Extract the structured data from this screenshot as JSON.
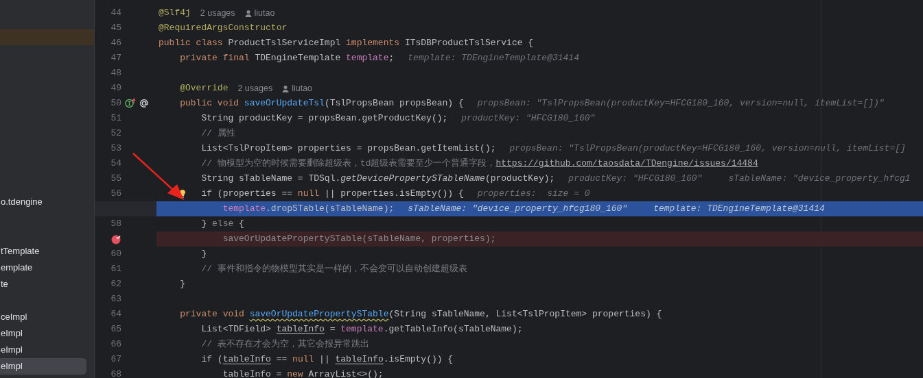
{
  "sidebar": {
    "items": [
      {
        "label": "o.tdengine",
        "selected": false
      },
      {
        "label": "tTemplate",
        "selected": false
      },
      {
        "label": "emplate",
        "selected": false
      },
      {
        "label": "te",
        "selected": false
      },
      {
        "label": "ceImpl",
        "selected": false
      },
      {
        "label": "eImpl",
        "selected": false
      },
      {
        "label": "eImpl",
        "selected": false
      },
      {
        "label": "eImpl",
        "selected": true
      }
    ]
  },
  "editor": {
    "lines": [
      {
        "number": "44",
        "kind": "normal",
        "code": [
          {
            "text": "@Slf4j",
            "kind": "annotation"
          }
        ],
        "hints": [
          {
            "kind": "usages",
            "text": "2 usages"
          },
          {
            "kind": "author",
            "text": "liutao"
          }
        ]
      },
      {
        "number": "45",
        "kind": "normal",
        "code": [
          {
            "text": "@RequiredArgsConstructor",
            "kind": "annotation"
          }
        ]
      },
      {
        "number": "46",
        "kind": "normal",
        "code": [
          {
            "text": "public class ",
            "kind": "keyword"
          },
          {
            "text": "ProductTslServiceImpl ",
            "kind": "plain"
          },
          {
            "text": "implements ",
            "kind": "keyword"
          },
          {
            "text": "ITsDBProductTslService {",
            "kind": "plain"
          }
        ]
      },
      {
        "number": "47",
        "kind": "normal",
        "code": [
          {
            "text": "    private final ",
            "kind": "keyword"
          },
          {
            "text": "TDEngineTemplate ",
            "kind": "plain"
          },
          {
            "text": "template",
            "kind": "field"
          },
          {
            "text": ";",
            "kind": "plain"
          }
        ],
        "hints": [
          {
            "kind": "value",
            "text": "template: TDEngineTemplate@31414"
          }
        ]
      },
      {
        "number": "48",
        "kind": "normal"
      },
      {
        "number": "49",
        "kind": "normal",
        "code": [
          {
            "text": "    @Override",
            "kind": "annotation"
          }
        ],
        "hints": [
          {
            "kind": "usages",
            "text": "2 usages"
          },
          {
            "kind": "author",
            "text": "liutao"
          }
        ]
      },
      {
        "number": "50",
        "kind": "normal",
        "icons": [
          {
            "kind": "override"
          },
          {
            "kind": "annotation"
          }
        ],
        "code": [
          {
            "text": "    public void ",
            "kind": "keyword"
          },
          {
            "text": "saveOrUpdateTsl",
            "kind": "method"
          },
          {
            "text": "(TslPropsBean propsBean) {",
            "kind": "plain"
          }
        ],
        "hints": [
          {
            "kind": "value",
            "text": "propsBean: \"TslPropsBean(productKey=HFCG180_160, version=null, itemList=[])\""
          }
        ]
      },
      {
        "number": "51",
        "kind": "normal",
        "code": [
          {
            "text": "        String productKey = propsBean.getProductKey();",
            "kind": "plain"
          }
        ],
        "hints": [
          {
            "kind": "value",
            "text": "productKey: \"HFCG180_160\""
          }
        ]
      },
      {
        "number": "52",
        "kind": "normal",
        "code": [
          {
            "text": "        // 属性",
            "kind": "comment"
          }
        ]
      },
      {
        "number": "53",
        "kind": "normal",
        "code": [
          {
            "text": "        List<TslPropItem> properties = propsBean.getItemList();",
            "kind": "plain"
          }
        ],
        "hints": [
          {
            "kind": "value",
            "text": "propsBean: \"TslPropsBean(productKey=HFCG180_160, version=null, itemList=[]"
          }
        ]
      },
      {
        "number": "54",
        "kind": "normal",
        "code": [
          {
            "text": "        // 物模型为空的时候需要删除超级表，td超级表需要至少一个普通字段，",
            "kind": "comment"
          },
          {
            "text": "https://github.com/taosdata/TDengine/issues/14484",
            "kind": "link"
          }
        ]
      },
      {
        "number": "55",
        "kind": "normal",
        "code": [
          {
            "text": "        String sTableName = TDSql.",
            "kind": "plain"
          },
          {
            "text": "getDevicePropertySTableName",
            "kind": "static"
          },
          {
            "text": "(productKey);",
            "kind": "plain"
          }
        ],
        "hints": [
          {
            "kind": "value",
            "text": "productKey: \"HFCG180_160\""
          },
          {
            "kind": "value",
            "text": "sTableName: \"device_property_hfcg1"
          }
        ]
      },
      {
        "number": "56",
        "kind": "normal",
        "icons": [
          {
            "kind": "bulb"
          }
        ],
        "code": [
          {
            "text": "        if (properties == ",
            "kind": "plain"
          },
          {
            "text": "null",
            "kind": "keyword"
          },
          {
            "text": " || properties.isEmpty()) {",
            "kind": "plain"
          }
        ],
        "hints": [
          {
            "kind": "value",
            "text": "properties:  size = 0"
          }
        ]
      },
      {
        "kind": "current",
        "code": [
          {
            "text": "            template",
            "kind": "field"
          },
          {
            "text": ".dropSTable(sTableName);",
            "kind": "plain"
          }
        ],
        "hints": [
          {
            "kind": "value",
            "text": "sTableName: \"device_property_hfcg180_160\""
          },
          {
            "kind": "value",
            "text": "template: TDEngineTemplate@31414"
          }
        ]
      },
      {
        "number": "58",
        "kind": "normal",
        "code": [
          {
            "text": "        } ",
            "kind": "plain"
          },
          {
            "text": "else",
            "kind": "unreached"
          },
          {
            "text": " {",
            "kind": "plain"
          }
        ]
      },
      {
        "kind": "breakpoint",
        "code": [
          {
            "text": "            saveOrUpdatePropertySTable(sTableName, properties);",
            "kind": "unreached"
          }
        ]
      },
      {
        "number": "60",
        "kind": "normal",
        "code": [
          {
            "text": "        }",
            "kind": "plain"
          }
        ]
      },
      {
        "number": "61",
        "kind": "normal",
        "code": [
          {
            "text": "        // 事件和指令的物模型其实是一样的，不会变可以自动创建超级表",
            "kind": "comment"
          }
        ]
      },
      {
        "number": "62",
        "kind": "normal",
        "code": [
          {
            "text": "    }",
            "kind": "plain"
          }
        ]
      },
      {
        "number": "63",
        "kind": "normal"
      },
      {
        "number": "64",
        "kind": "normal",
        "code": [
          {
            "text": "    private void ",
            "kind": "keyword"
          },
          {
            "text": "saveOrUpdatePropertySTable",
            "kind": "warning"
          },
          {
            "text": "(String sTableName, List<TslPropItem> properties) {",
            "kind": "plain"
          }
        ]
      },
      {
        "number": "65",
        "kind": "normal",
        "code": [
          {
            "text": "        List<TDField> ",
            "kind": "plain"
          },
          {
            "text": "tableInfo",
            "kind": "reassigned"
          },
          {
            "text": " = ",
            "kind": "plain"
          },
          {
            "text": "template",
            "kind": "field"
          },
          {
            "text": ".getTableInfo(sTableName);",
            "kind": "plain"
          }
        ]
      },
      {
        "number": "66",
        "kind": "normal",
        "code": [
          {
            "text": "        // 表不存在才会为空，其它会报异常跳出",
            "kind": "comment"
          }
        ]
      },
      {
        "number": "67",
        "kind": "normal",
        "code": [
          {
            "text": "        if (",
            "kind": "plain"
          },
          {
            "text": "tableInfo",
            "kind": "reassigned"
          },
          {
            "text": " == ",
            "kind": "plain"
          },
          {
            "text": "null",
            "kind": "keyword"
          },
          {
            "text": " || ",
            "kind": "plain"
          },
          {
            "text": "tableInfo",
            "kind": "reassigned"
          },
          {
            "text": ".isEmpty()) {",
            "kind": "plain"
          }
        ]
      },
      {
        "number": "68",
        "kind": "normal",
        "code": [
          {
            "text": "            tableInfo",
            "kind": "reassigned"
          },
          {
            "text": " = ",
            "kind": "plain"
          },
          {
            "text": "new",
            "kind": "keyword"
          },
          {
            "text": " ArrayList<>();",
            "kind": "plain"
          }
        ]
      }
    ]
  }
}
